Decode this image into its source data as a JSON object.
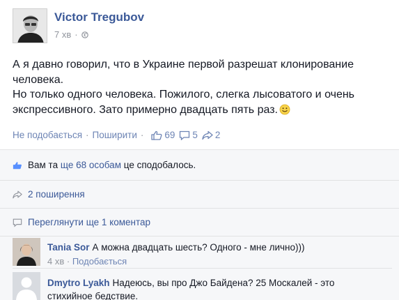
{
  "post": {
    "author": "Victor Tregubov",
    "time": "7 хв",
    "privacy_icon": "globe-icon",
    "text_lines": [
      "А я давно говорил, что в Украине первой разрешат клонирование",
      "человека.",
      "Но только одного человека. Пожилого, слегка лысоватого и очень",
      "экспрессивного. Зато примерно двадцать пять раз."
    ],
    "emoji": "smiley-emoji"
  },
  "actions": {
    "unlike_label": "Не подобається",
    "share_label": "Поширити",
    "likes_count": "69",
    "comments_count": "5",
    "shares_count": "2"
  },
  "ufi": {
    "likes_prefix": "Вам та",
    "likes_link": "ще 68 особам",
    "likes_suffix": "це сподобалось.",
    "shares_label": "2 поширення",
    "more_comments_label": "Переглянути ще 1 коментар"
  },
  "comments": [
    {
      "author": "Tania Sor",
      "text": "А можна двадцать шесть? Одного - мне лично)))",
      "time": "4 хв",
      "like_label": "Подобається"
    },
    {
      "author": "Dmytro Lyakh",
      "text": "Надеюсь, вы про Джо Байдена? 25 Москалей - это стихийное бедствие."
    }
  ],
  "colors": {
    "link": "#3b5998",
    "action_link": "#6d84b4",
    "meta_gray": "#90949c",
    "ufi_bg": "#f6f7f9"
  }
}
